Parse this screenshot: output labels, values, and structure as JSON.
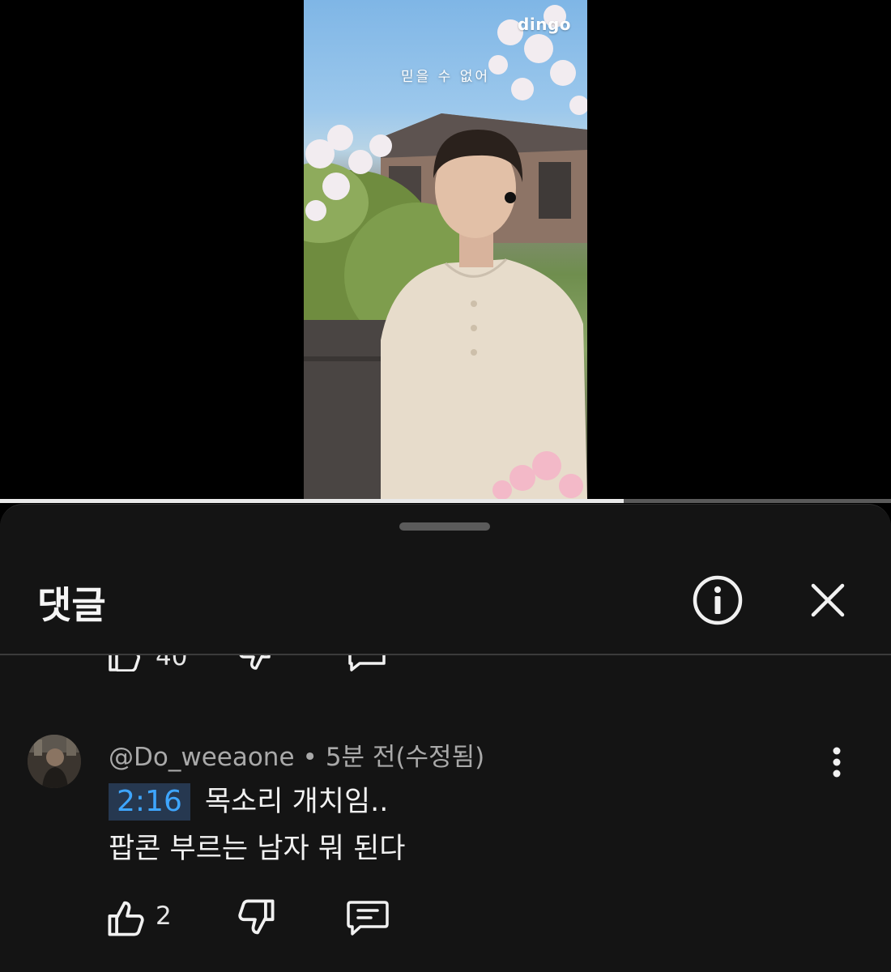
{
  "video": {
    "watermark": "dingo",
    "subtitle": "믿을 수 없어",
    "progress": 0.7
  },
  "comments_panel": {
    "title": "댓글",
    "info_icon": "info-circle-icon",
    "close_icon": "close-icon"
  },
  "previous_comment": {
    "like_count": "40"
  },
  "comment": {
    "author": "@Do_weeaone",
    "separator": "•",
    "time": "5분 전(수정됨)",
    "timestamp": "2:16",
    "text_line1": "목소리 개치임..",
    "text_line2": "팝콘 부르는 남자 뭐 된다",
    "like_count": "2",
    "icons": {
      "like": "thumbs-up-icon",
      "dislike": "thumbs-down-icon",
      "reply": "reply-comment-icon",
      "more": "more-vertical-icon"
    }
  },
  "colors": {
    "sheet_background": "#141414",
    "timestamp_link": "#3ea6ff",
    "timestamp_bg": "#263850",
    "meta_text": "#a9a9a9"
  }
}
